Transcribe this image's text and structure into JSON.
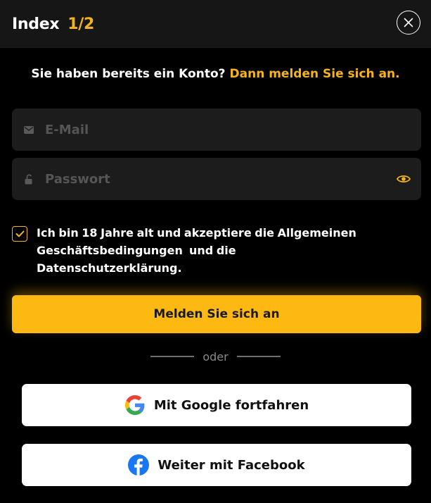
{
  "header": {
    "title": "Index",
    "page_indicator": "1/2",
    "close_icon": "close-icon"
  },
  "prompt": {
    "text": "Sie haben bereits ein Konto?",
    "login_link": "Dann melden Sie sich an."
  },
  "form": {
    "email_placeholder": "E-Mail",
    "email_value": "",
    "email_icon": "mail-icon",
    "password_placeholder": "Passwort",
    "password_value": "",
    "password_icon": "unlock-icon",
    "show_password_icon": "eye-icon"
  },
  "consent": {
    "checked": true,
    "text_line1": "Ich bin 18 Jahre alt und akzeptiere die Allgemeinen",
    "terms_link": "Geschäftsbedingungen",
    "and_text": "und die",
    "privacy_link": "Datenschutzerklärung",
    "period": "."
  },
  "submit_label": "Melden Sie sich an",
  "divider_label": "oder",
  "social": {
    "google_label": "Mit Google fortfahren",
    "google_icon": "google-icon",
    "facebook_label": "Weiter mit Facebook",
    "facebook_icon": "facebook-icon"
  },
  "colors": {
    "accent": "#f5b41b",
    "button": "#fdb812",
    "background": "#000000",
    "header": "#161616",
    "field": "#1c1c1c",
    "facebook": "#1877f2"
  }
}
